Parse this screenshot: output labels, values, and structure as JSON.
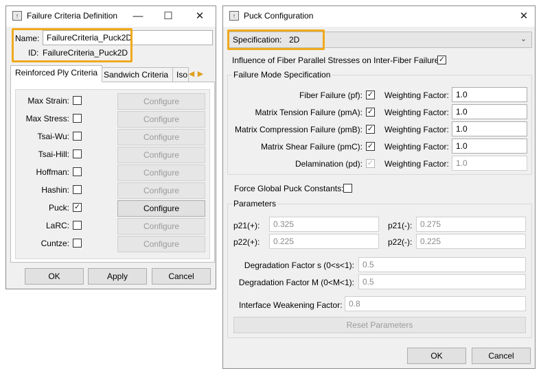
{
  "left_window": {
    "title": "Failure Criteria Definition",
    "name_label": "Name:",
    "name_value": "FailureCriteria_Puck2D",
    "id_label": "ID:",
    "id_value": "FailureCriteria_Puck2D",
    "tabs": [
      "Reinforced Ply Criteria",
      "Sandwich Criteria",
      "Iso"
    ],
    "criteria": [
      {
        "label": "Max Strain:",
        "checked": false,
        "configure_enabled": false
      },
      {
        "label": "Max Stress:",
        "checked": false,
        "configure_enabled": false
      },
      {
        "label": "Tsai-Wu:",
        "checked": false,
        "configure_enabled": false
      },
      {
        "label": "Tsai-Hill:",
        "checked": false,
        "configure_enabled": false
      },
      {
        "label": "Hoffman:",
        "checked": false,
        "configure_enabled": false
      },
      {
        "label": "Hashin:",
        "checked": false,
        "configure_enabled": false
      },
      {
        "label": "Puck:",
        "checked": true,
        "configure_enabled": true
      },
      {
        "label": "LaRC:",
        "checked": false,
        "configure_enabled": false
      },
      {
        "label": "Cuntze:",
        "checked": false,
        "configure_enabled": false
      }
    ],
    "configure_label": "Configure",
    "buttons": {
      "ok": "OK",
      "apply": "Apply",
      "cancel": "Cancel"
    }
  },
  "right_window": {
    "title": "Puck Configuration",
    "specification_label": "Specification:",
    "specification_value": "2D",
    "influence_label": "Influence of Fiber Parallel Stresses on Inter-Fiber Failure:",
    "influence_checked": true,
    "failure_mode_group": "Failure Mode Specification",
    "weighting_label": "Weighting Factor:",
    "modes": [
      {
        "label": "Fiber Failure (pf):",
        "checked": true,
        "enabled": true,
        "weight": "1.0"
      },
      {
        "label": "Matrix Tension Failure (pmA):",
        "checked": true,
        "enabled": true,
        "weight": "1.0"
      },
      {
        "label": "Matrix Compression Failure (pmB):",
        "checked": true,
        "enabled": true,
        "weight": "1.0"
      },
      {
        "label": "Matrix Shear Failure (pmC):",
        "checked": true,
        "enabled": true,
        "weight": "1.0"
      },
      {
        "label": "Delamination (pd):",
        "checked": true,
        "enabled": false,
        "weight": "1.0"
      }
    ],
    "force_global_label": "Force Global Puck Constants:",
    "force_global_checked": false,
    "parameters_group": "Parameters",
    "params": {
      "p21_plus_label": "p21(+):",
      "p21_plus": "0.325",
      "p21_minus_label": "p21(-):",
      "p21_minus": "0.275",
      "p22_plus_label": "p22(+):",
      "p22_plus": "0.225",
      "p22_minus_label": "p22(-):",
      "p22_minus": "0.225",
      "deg_s_label": "Degradation Factor s (0<s<1):",
      "deg_s": "0.5",
      "deg_m_label": "Degradation Factor M (0<M<1):",
      "deg_m": "0.5",
      "interface_label": "Interface Weakening Factor:",
      "interface": "0.8"
    },
    "reset_label": "Reset Parameters",
    "buttons": {
      "ok": "OK",
      "cancel": "Cancel"
    }
  },
  "colors": {
    "highlight": "#f0a91c",
    "window_bg": "#f0f0f0"
  }
}
